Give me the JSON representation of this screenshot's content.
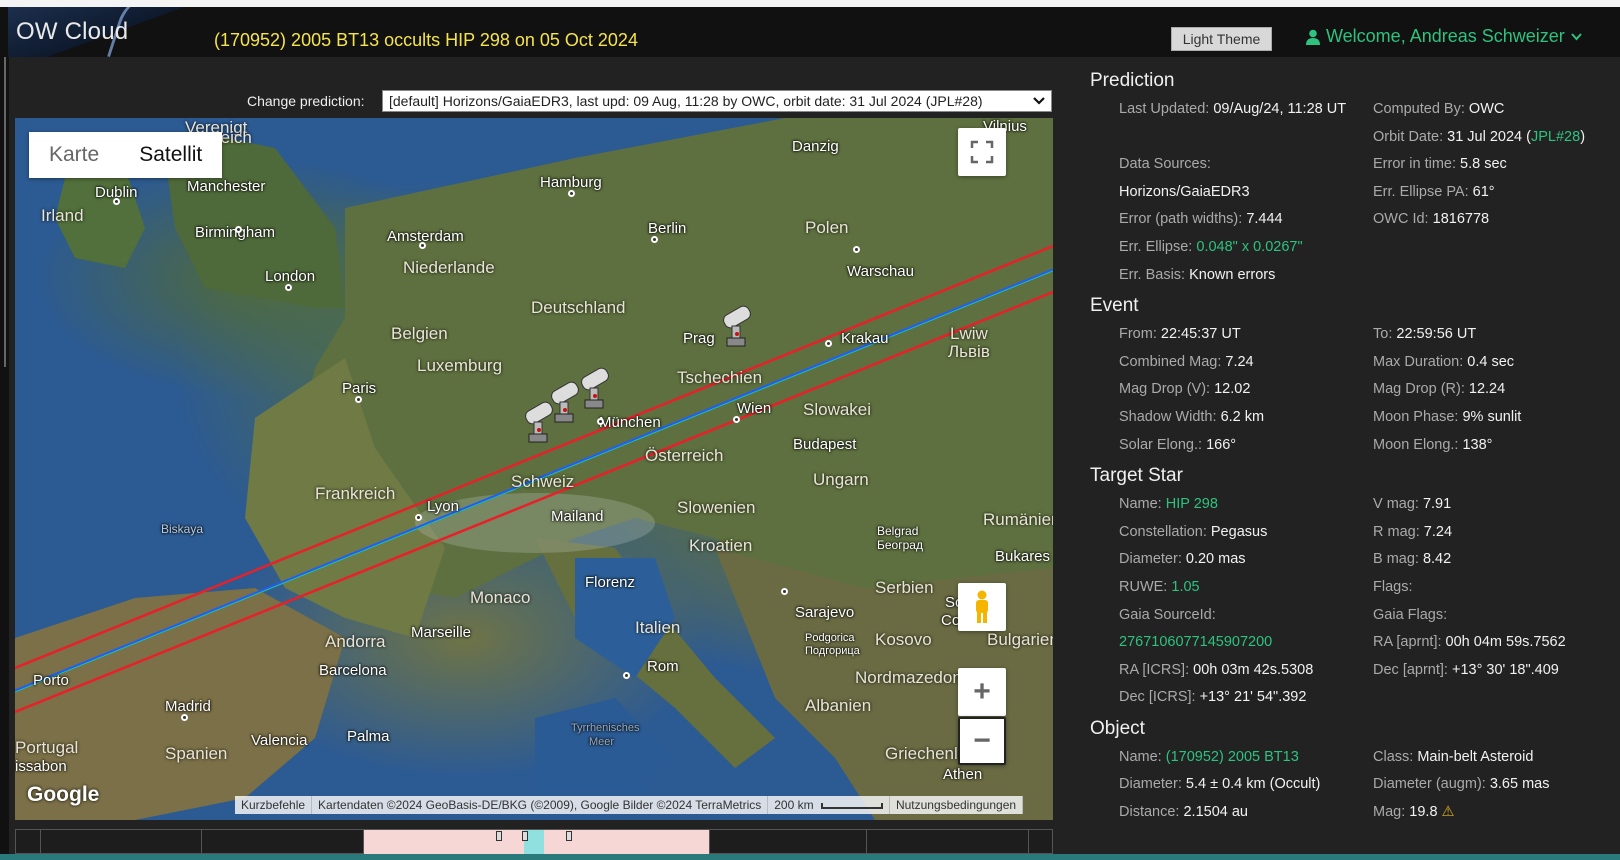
{
  "header": {
    "logo": "OW Cloud",
    "title": "(170952) 2005 BT13 occults HIP 298 on 05 Oct 2024",
    "theme_button": "Light Theme",
    "welcome": "Welcome, Andreas Schweizer"
  },
  "prediction_select": {
    "label": "Change prediction:",
    "value": "[default] Horizons/GaiaEDR3, last upd: 09 Aug, 11:28 by OWC, orbit date: 31 Jul 2024 (JPL#28)"
  },
  "map": {
    "type_buttons": [
      "Karte",
      "Satellit"
    ],
    "selected_type": "Satellit",
    "google": "Google",
    "attribution": [
      "Kurzbefehle",
      "Kartendaten ©2024 GeoBasis-DE/BKG (©2009), Google Bilder ©2024 TerraMetrics",
      "200 km",
      "Nutzungsbedingungen"
    ],
    "places": {
      "verenigt": "Verenigt",
      "reich": "reich",
      "dublin": "Dublin",
      "irland": "Irland",
      "manchester": "Manchester",
      "birmingham": "Birmingham",
      "london": "London",
      "amsterdam": "Amsterdam",
      "niederlande": "Niederlande",
      "hamburg": "Hamburg",
      "danzig": "Danzig",
      "vilnius": "Vilnius",
      "berlin": "Berlin",
      "polen": "Polen",
      "warschau": "Warschau",
      "deutschland": "Deutschland",
      "belgien": "Belgien",
      "luxemburg": "Luxemburg",
      "paris": "Paris",
      "prag": "Prag",
      "krakau": "Krakau",
      "lwiw": "Lwiw",
      "lwiw_cyr": "Львів",
      "tschechien": "Tschechien",
      "muenchen": "München",
      "wien": "Wien",
      "slowakei": "Slowakei",
      "budapest": "Budapest",
      "oesterreich": "Österreich",
      "ungarn": "Ungarn",
      "frankreich": "Frankreich",
      "schweiz": "Schweiz",
      "lyon": "Lyon",
      "mailand": "Mailand",
      "slowenien": "Slowenien",
      "rumaenien": "Rumänien",
      "kroatien": "Kroatien",
      "belgrad": "Belgrad",
      "belgrad_cyr": "Београд",
      "bukarest": "Bukares",
      "biskaya": "Biskaya",
      "florenz": "Florenz",
      "serbien": "Serbien",
      "monaco": "Monaco",
      "sarajevo": "Sarajevo",
      "sofia": "Sofia",
      "sofia_cyr": "София",
      "marseille": "Marseille",
      "italien": "Italien",
      "bulgarien": "Bulgarien",
      "andorra": "Andorra",
      "podgorica": "Podgorica",
      "podgorica_cyr": "Подгорица",
      "kosovo": "Kosovo",
      "barcelona": "Barcelona",
      "rom": "Rom",
      "nordmazedonien": "Nordmazedonien",
      "porto": "Porto",
      "madrid": "Madrid",
      "albanien": "Albanien",
      "portugal": "Portugal",
      "valencia": "Valencia",
      "palma": "Palma",
      "tyrrhenisches": "Tyrrhenisches",
      "meer": "Meer",
      "griechenland": "Griechenland",
      "spanien": "Spanien",
      "lissabon": "issabon",
      "athen": "Athen"
    }
  },
  "panel": {
    "prediction": {
      "title": "Prediction",
      "last_updated_label": "Last Updated:",
      "last_updated": "09/Aug/24, 11:28 UT",
      "computed_by_label": "Computed By:",
      "computed_by": "OWC",
      "data_sources_label": "Data Sources:",
      "data_sources": "Horizons/GaiaEDR3",
      "orbit_date_label": "Orbit Date:",
      "orbit_date": "31 Jul 2024",
      "orbit_ref": "JPL#28",
      "error_time_label": "Error in time:",
      "error_time": "5.8 sec",
      "error_path_label": "Error (path widths):",
      "error_path": "7.444",
      "ellipse_pa_label": "Err. Ellipse PA:",
      "ellipse_pa": "61°",
      "err_ellipse_label": "Err. Ellipse:",
      "err_ellipse": "0.048\" x 0.0267\"",
      "owc_id_label": "OWC Id:",
      "owc_id": "1816778",
      "err_basis_label": "Err. Basis:",
      "err_basis": "Known errors"
    },
    "event": {
      "title": "Event",
      "from_label": "From:",
      "from": "22:45:37 UT",
      "to_label": "To:",
      "to": "22:59:56 UT",
      "combined_mag_label": "Combined Mag:",
      "combined_mag": "7.24",
      "max_duration_label": "Max Duration:",
      "max_duration": "0.4 sec",
      "mag_drop_v_label": "Mag Drop (V):",
      "mag_drop_v": "12.02",
      "mag_drop_r_label": "Mag Drop (R):",
      "mag_drop_r": "12.24",
      "shadow_width_label": "Shadow Width:",
      "shadow_width": "6.2 km",
      "moon_phase_label": "Moon Phase:",
      "moon_phase": "9% sunlit",
      "solar_elong_label": "Solar Elong.:",
      "solar_elong": "166°",
      "moon_elong_label": "Moon Elong.:",
      "moon_elong": "138°"
    },
    "star": {
      "title": "Target Star",
      "name_label": "Name:",
      "name": "HIP 298",
      "vmag_label": "V mag:",
      "vmag": "7.91",
      "constellation_label": "Constellation:",
      "constellation": "Pegasus",
      "rmag_label": "R mag:",
      "rmag": "7.24",
      "diameter_label": "Diameter:",
      "diameter": "0.20 mas",
      "bmag_label": "B mag:",
      "bmag": "8.42",
      "ruwe_label": "RUWE:",
      "ruwe": "1.05",
      "flags_label": "Flags:",
      "gaia_source_label": "Gaia SourceId:",
      "gaia_source": "2767106077145907200",
      "gaia_flags_label": "Gaia Flags:",
      "ra_icrs_label": "RA [ICRS]:",
      "ra_icrs": "00h 03m 42s.5308",
      "ra_aprnt_label": "RA [aprnt]:",
      "ra_aprnt": "00h 04m 59s.7562",
      "dec_icrs_label": "Dec [ICRS]:",
      "dec_icrs": "+13° 21' 54\".392",
      "dec_aprnt_label": "Dec [aprnt]:",
      "dec_aprnt": "+13° 30' 18\".409"
    },
    "object": {
      "title": "Object",
      "name_label": "Name:",
      "name": "(170952) 2005 BT13",
      "class_label": "Class:",
      "class": "Main-belt Asteroid",
      "diameter_label": "Diameter:",
      "diameter": "5.4 ± 0.4 km",
      "diameter_src": "(Occult)",
      "diameter_augm_label": "Diameter (augm):",
      "diameter_augm": "3.65 mas",
      "distance_label": "Distance:",
      "distance": "2.1504 au",
      "mag_label": "Mag:",
      "mag": "19.8"
    }
  },
  "colors": {
    "accent_green": "#2ec27e",
    "title_yellow": "#f5e44a",
    "path_red": "#e8202a",
    "path_blue": "#1e5cff"
  }
}
